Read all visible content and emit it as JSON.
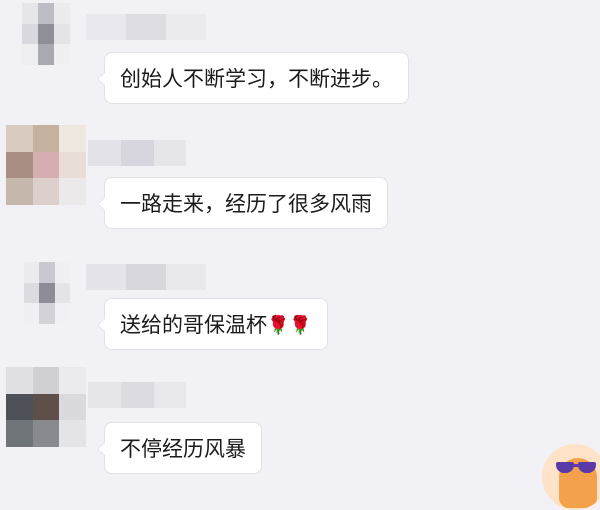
{
  "messages": [
    {
      "sender": "",
      "text": "创始人不断学习，不断进步。"
    },
    {
      "sender": "",
      "text": "一路走来，经历了很多风雨"
    },
    {
      "sender": "",
      "text": "送给的哥保温杯",
      "emoji": "🌹🌹"
    },
    {
      "sender": "",
      "text": "不停经历风暴"
    }
  ],
  "colors": {
    "background": "#f2f1f5",
    "bubble": "#ffffff",
    "bubble_border": "#e2e1e6",
    "text": "#1b1b1b"
  },
  "icons": [
    "blurred-avatar-icon",
    "rose-emoji-icon",
    "sunglasses-avatar-icon"
  ]
}
